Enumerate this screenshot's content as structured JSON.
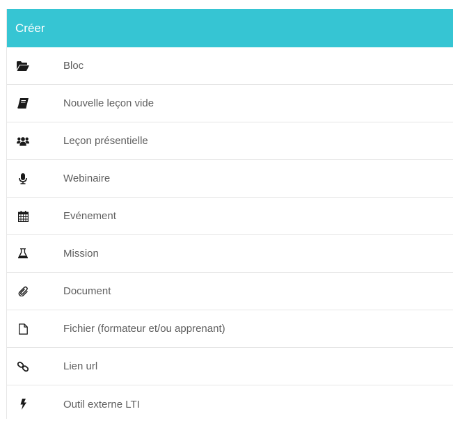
{
  "panel": {
    "title": "Créer",
    "accent_color": "#36c5d3",
    "items": [
      {
        "label": "Bloc",
        "icon": "folder-open-icon"
      },
      {
        "label": "Nouvelle leçon vide",
        "icon": "book-icon"
      },
      {
        "label": "Leçon présentielle",
        "icon": "users-icon"
      },
      {
        "label": "Webinaire",
        "icon": "microphone-icon"
      },
      {
        "label": "Evénement",
        "icon": "calendar-icon"
      },
      {
        "label": "Mission",
        "icon": "flask-icon"
      },
      {
        "label": "Document",
        "icon": "paperclip-icon"
      },
      {
        "label": "Fichier (formateur et/ou apprenant)",
        "icon": "file-icon"
      },
      {
        "label": "Lien url",
        "icon": "link-icon"
      },
      {
        "label": "Outil externe LTI",
        "icon": "bolt-icon"
      }
    ]
  }
}
